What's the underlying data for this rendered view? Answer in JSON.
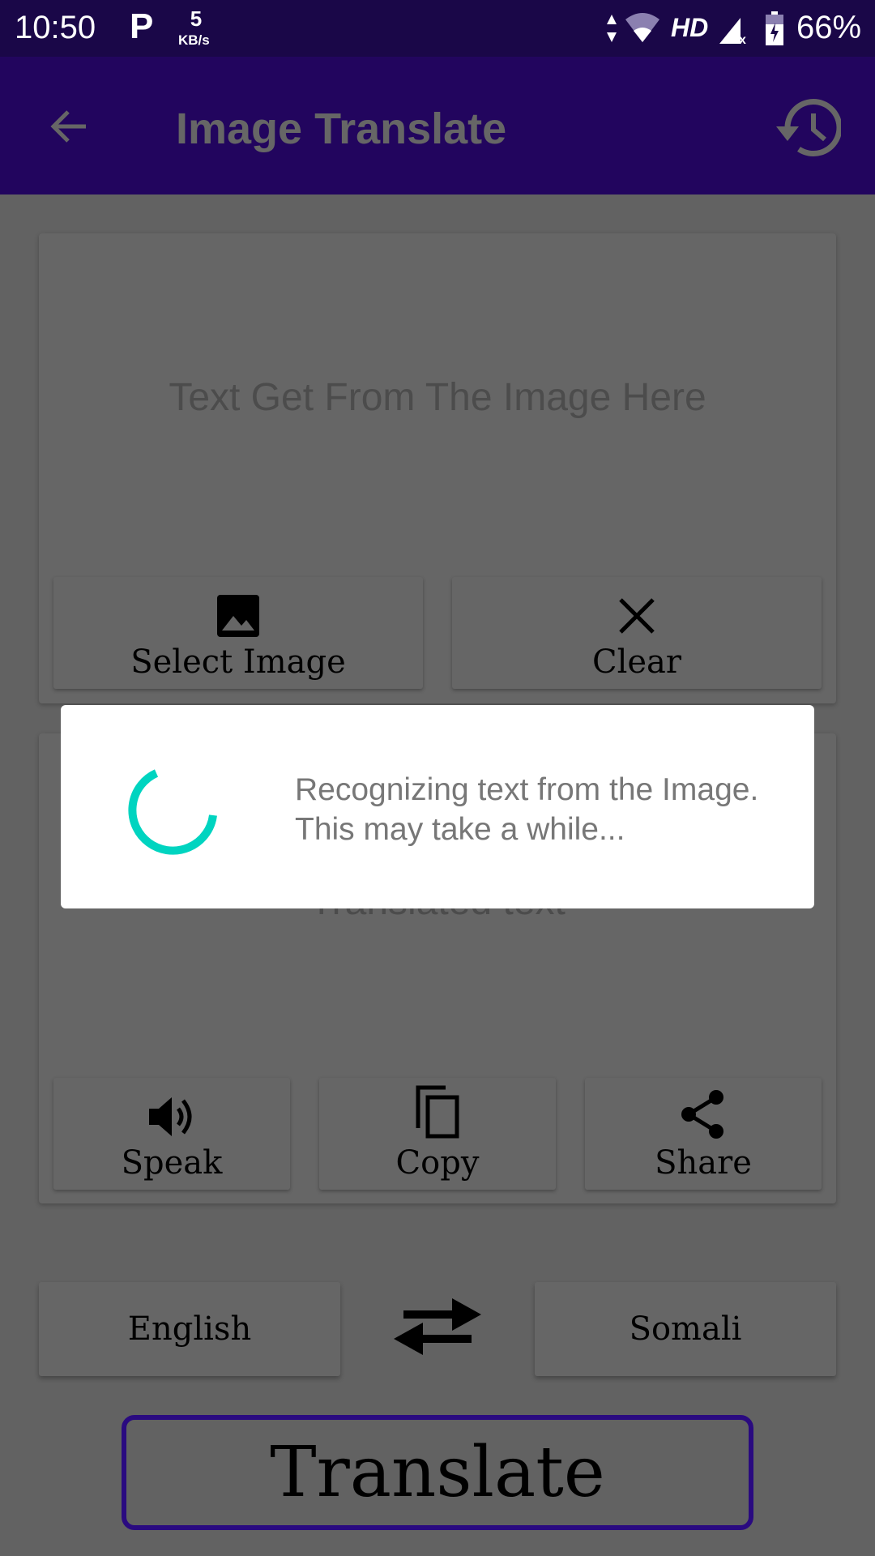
{
  "status_bar": {
    "time": "10:50",
    "net_speed_value": "5",
    "net_speed_unit": "KB/s",
    "network": "HD",
    "battery": "66%"
  },
  "app_bar": {
    "title": "Image Translate",
    "back_icon": "arrow-left-icon",
    "history_icon": "history-icon"
  },
  "source_card": {
    "placeholder": "Text Get From The Image Here",
    "select_image_label": "Select Image",
    "clear_label": "Clear"
  },
  "target_card": {
    "placeholder": "Translated text",
    "speak_label": "Speak",
    "copy_label": "Copy",
    "share_label": "Share"
  },
  "languages": {
    "source": "English",
    "target": "Somali",
    "swap_icon": "swap-arrows-icon"
  },
  "translate_label": "Translate",
  "dialog": {
    "message": "Recognizing text from the Image. This may take a while...",
    "spinner_color": "#00d4c0"
  },
  "colors": {
    "primary_dark": "#1a0748",
    "primary": "#22055e",
    "accent": "#2a0a80"
  }
}
